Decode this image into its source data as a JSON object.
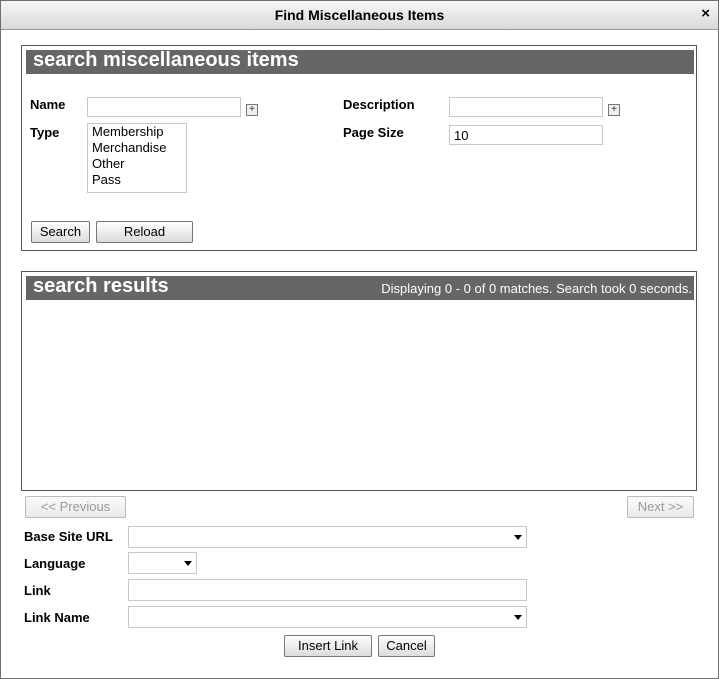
{
  "window": {
    "title": "Find Miscellaneous Items",
    "close_glyph": "×"
  },
  "search_panel": {
    "heading": "search miscellaneous items",
    "name_label": "Name",
    "name_value": "",
    "description_label": "Description",
    "description_value": "",
    "type_label": "Type",
    "type_options": [
      "Membership",
      "Merchandise",
      "Other",
      "Pass"
    ],
    "page_size_label": "Page Size",
    "page_size_value": "10",
    "search_button": "Search",
    "reload_button": "Reload"
  },
  "results_panel": {
    "heading": "search results",
    "status": "Displaying 0 - 0 of 0 matches. Search took 0 seconds."
  },
  "pager": {
    "previous": "<< Previous",
    "next": "Next >>"
  },
  "link_form": {
    "base_site_url_label": "Base Site URL",
    "base_site_url_value": "",
    "language_label": "Language",
    "language_value": "",
    "link_label": "Link",
    "link_value": "",
    "link_name_label": "Link Name",
    "link_name_value": ""
  },
  "actions": {
    "insert_link": "Insert Link",
    "cancel": "Cancel"
  },
  "colors": {
    "panel_header": "#666666",
    "border": "#555555"
  }
}
